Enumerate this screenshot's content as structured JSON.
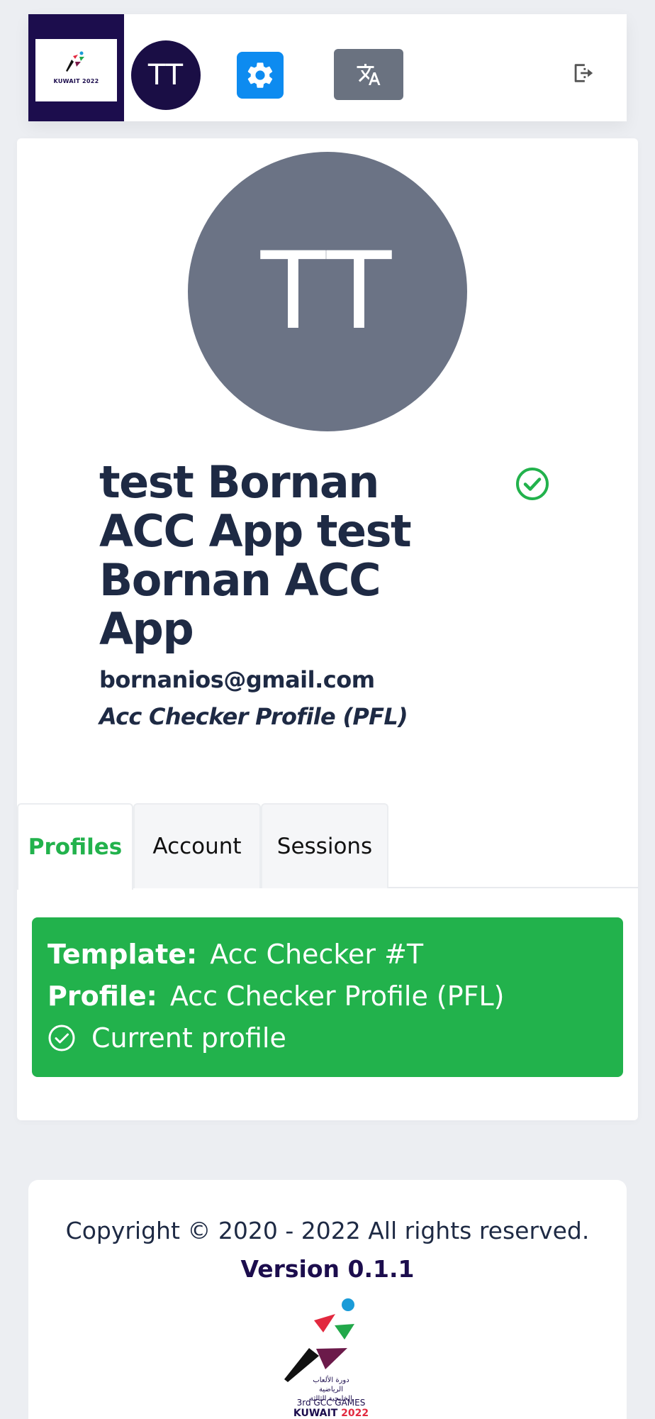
{
  "header": {
    "logo_text": "KUWAIT 2022",
    "avatar_initials": "TT"
  },
  "profile": {
    "avatar_initials": "TT",
    "name": "test Bornan ACC App test Bornan ACC App",
    "email": "bornanios@gmail.com",
    "profile_name": "Acc Checker Profile (PFL)"
  },
  "tabs": [
    {
      "label": "Profiles",
      "active": true
    },
    {
      "label": "Account",
      "active": false
    },
    {
      "label": "Sessions",
      "active": false
    }
  ],
  "current_profile": {
    "template_label": "Template:",
    "template_value": "Acc Checker #T",
    "profile_label": "Profile:",
    "profile_value": "Acc Checker Profile (PFL)",
    "status_text": "Current profile"
  },
  "footer": {
    "copyright": "Copyright © 2020 - 2022 All rights reserved.",
    "version": "Version 0.1.1",
    "logo_arabic": "دورة الألعاب الرياضية الخليجية الثالثة",
    "logo_games": "3rd GCC GAMES",
    "logo_kuwait": "KUWAIT",
    "logo_year": "2022"
  },
  "colors": {
    "brand_navy": "#1c0d4d",
    "accent_blue": "#0d8bf0",
    "success_green": "#22b24c",
    "avatar_gray": "#6b7385"
  }
}
